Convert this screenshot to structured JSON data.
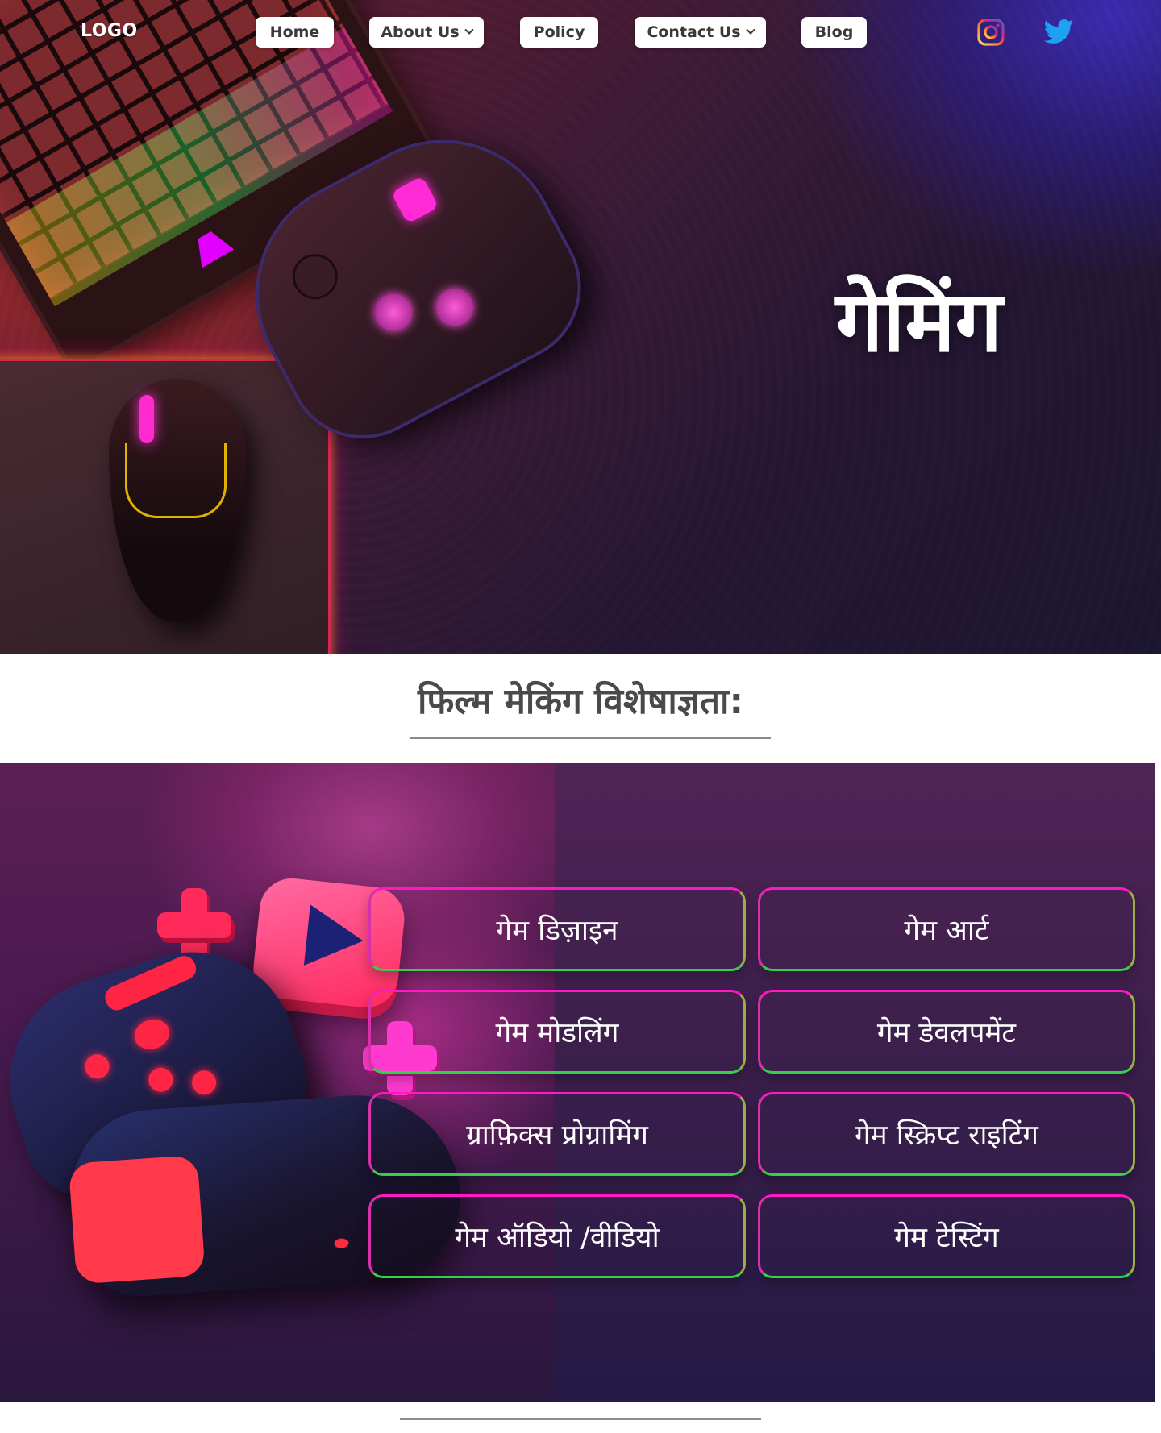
{
  "nav": {
    "logo": "LOGO",
    "items": [
      {
        "label": "Home",
        "dropdown": false
      },
      {
        "label": "About Us",
        "dropdown": true
      },
      {
        "label": "Policy",
        "dropdown": false
      },
      {
        "label": "Contact Us",
        "dropdown": true
      },
      {
        "label": "Blog",
        "dropdown": false
      }
    ],
    "social": [
      {
        "icon": "instagram-icon"
      },
      {
        "icon": "twitter-icon"
      }
    ]
  },
  "hero": {
    "title": "गेमिंग"
  },
  "section": {
    "title": "फिल्म मेकिंग विशेषाज्ञता:"
  },
  "services": [
    "गेम डिज़ाइन",
    "गेम आर्ट",
    "गेम मोडलिंग",
    "गेम  डेवलपमेंट",
    "ग्राफ़िक्स प्रोग्रामिंग",
    "गेम स्क्रिप्ट राइटिंग",
    "गेम ऑडियो /वीडियो",
    "गेम टेस्टिंग"
  ],
  "colors": {
    "card_border_top": "#ff19c5",
    "card_border_bottom": "#33d14b",
    "twitter": "#1da1f2"
  }
}
